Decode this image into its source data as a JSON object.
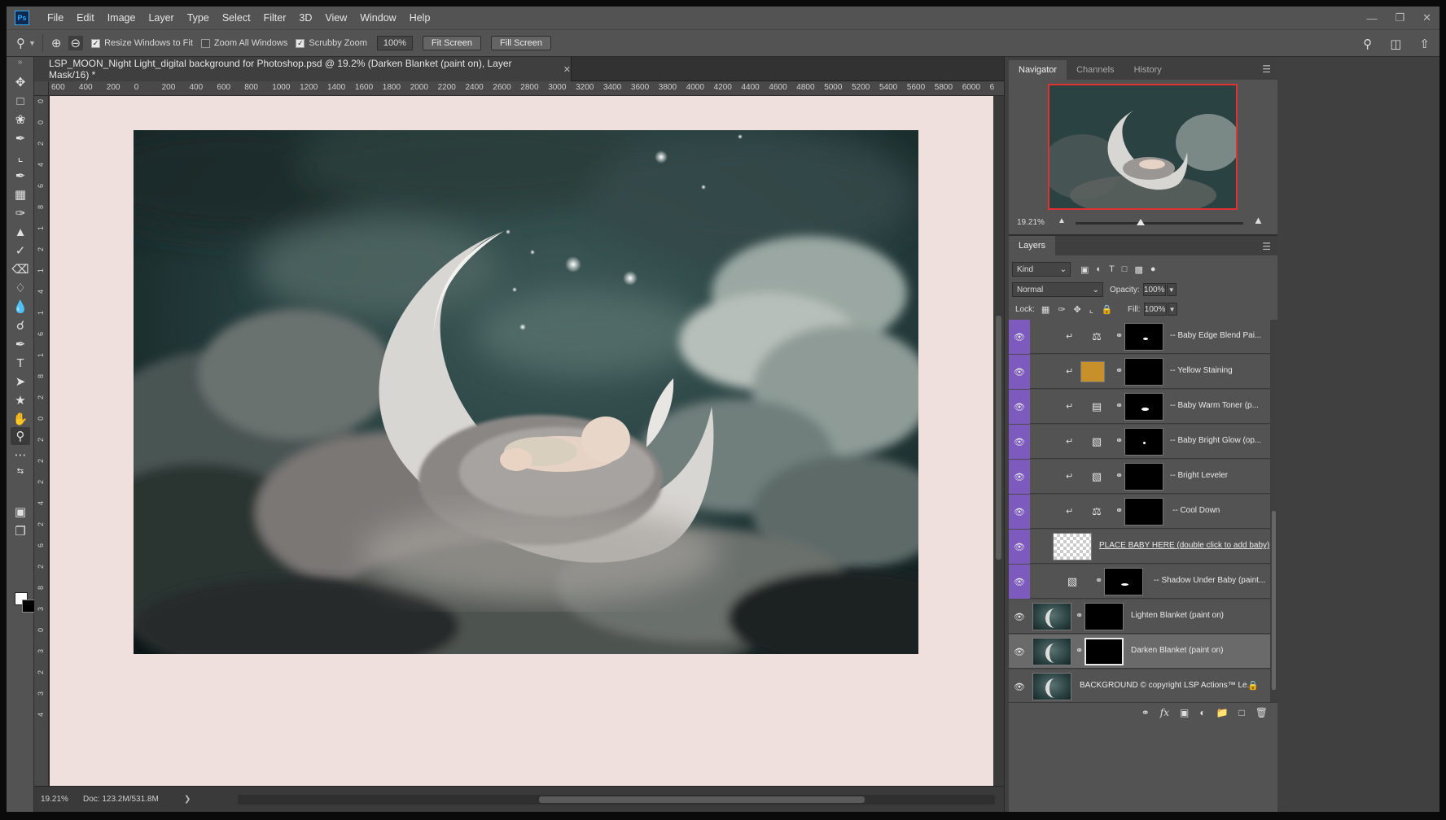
{
  "app": {
    "logo": "Ps"
  },
  "menu": [
    "File",
    "Edit",
    "Image",
    "Layer",
    "Type",
    "Select",
    "Filter",
    "3D",
    "View",
    "Window",
    "Help"
  ],
  "options": {
    "resize_windows": "Resize Windows to Fit",
    "zoom_all": "Zoom All Windows",
    "scrubby": "Scrubby Zoom",
    "zoom_value": "100%",
    "fit_screen": "Fit Screen",
    "fill_screen": "Fill Screen"
  },
  "document": {
    "tab_title": "LSP_MOON_Night Light_digital background for Photoshop.psd @ 19.2% (Darken Blanket (paint on), Layer Mask/16) *",
    "ruler_h": [
      "600",
      "400",
      "200",
      "0",
      "200",
      "400",
      "600",
      "800",
      "1000",
      "1200",
      "1400",
      "1600",
      "1800",
      "2000",
      "2200",
      "2400",
      "2600",
      "2800",
      "3000",
      "3200",
      "3400",
      "3600",
      "3800",
      "4000",
      "4200",
      "4400",
      "4600",
      "4800",
      "5000",
      "5200",
      "5400",
      "5600",
      "5800",
      "6000",
      "6"
    ],
    "ruler_v": [
      "0",
      "0",
      "2",
      "4",
      "6",
      "8",
      "1",
      "2",
      "1",
      "4",
      "1",
      "6",
      "1",
      "8",
      "2",
      "0",
      "2",
      "2",
      "2",
      "4",
      "2",
      "6",
      "2",
      "8",
      "3",
      "0",
      "3",
      "2",
      "3",
      "4"
    ],
    "status_zoom": "19.21%",
    "status_doc": "Doc: 123.2M/531.8M"
  },
  "navigator": {
    "tabs": [
      "Navigator",
      "Channels",
      "History"
    ],
    "zoom": "19.21%",
    "zoom_level": 0.39
  },
  "layers_panel": {
    "tab": "Layers",
    "kind": "Kind",
    "blend_mode": "Normal",
    "opacity_label": "Opacity:",
    "opacity": "100%",
    "lock_label": "Lock:",
    "fill_label": "Fill:",
    "fill": "100%",
    "layers": [
      {
        "name": "-- Baby Edge Blend Pai...",
        "type": "adjustment",
        "icon": "balance-icon",
        "clipped": true
      },
      {
        "name": "-- Yellow Staining",
        "type": "color-fill",
        "color": "#c8902a",
        "clipped": true
      },
      {
        "name": "-- Baby Warm Toner (p...",
        "type": "adjustment",
        "icon": "filmstrip-icon",
        "clipped": true
      },
      {
        "name": "-- Baby Bright Glow (op...",
        "type": "adjustment",
        "icon": "levels-icon",
        "clipped": true
      },
      {
        "name": "-- Bright Leveler",
        "type": "adjustment",
        "icon": "levels-icon",
        "clipped": true
      },
      {
        "name": "-- Cool Down",
        "type": "adjustment",
        "icon": "balance-icon",
        "clipped": true
      },
      {
        "name": "PLACE BABY HERE (double click to add baby)",
        "type": "smart-object",
        "clipped": false
      },
      {
        "name": "-- Shadow Under Baby (paint...",
        "type": "adjustment",
        "icon": "levels-icon",
        "clipped": false
      },
      {
        "name": "Lighten Blanket (paint on)",
        "type": "photo-mask",
        "clipped": false
      },
      {
        "name": "Darken Blanket (paint on)",
        "type": "photo-mask",
        "clipped": false,
        "selected": true
      },
      {
        "name": "BACKGROUND © copyright  LSP Actions™  Le...",
        "type": "background",
        "clipped": false,
        "locked": true
      }
    ]
  },
  "colors": {
    "layer_clip_bar": "#7d5bbe",
    "navigator_frame": "#e03232",
    "canvas_pasteboard": "#efe0dd"
  }
}
